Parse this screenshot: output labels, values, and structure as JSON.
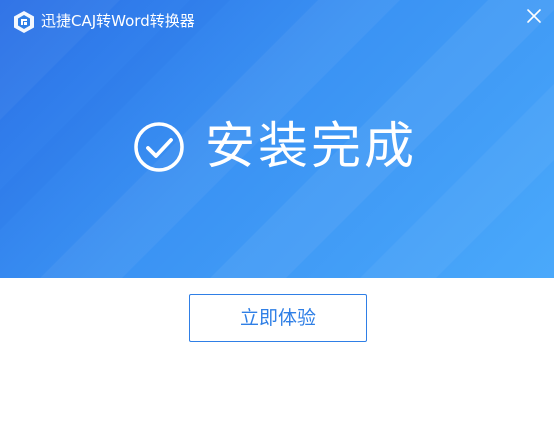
{
  "window": {
    "title": "迅捷CAJ转Word转换器"
  },
  "icons": {
    "logo": "app-logo-icon",
    "close": "close-icon",
    "status": "check-circle-icon"
  },
  "status": {
    "message": "安装完成"
  },
  "actions": {
    "try_now_label": "立即体验"
  },
  "colors": {
    "banner_start": "#2a6fe6",
    "banner_end": "#4aa9fb",
    "accent": "#2f7fe6",
    "text_on_banner": "#ffffff"
  }
}
